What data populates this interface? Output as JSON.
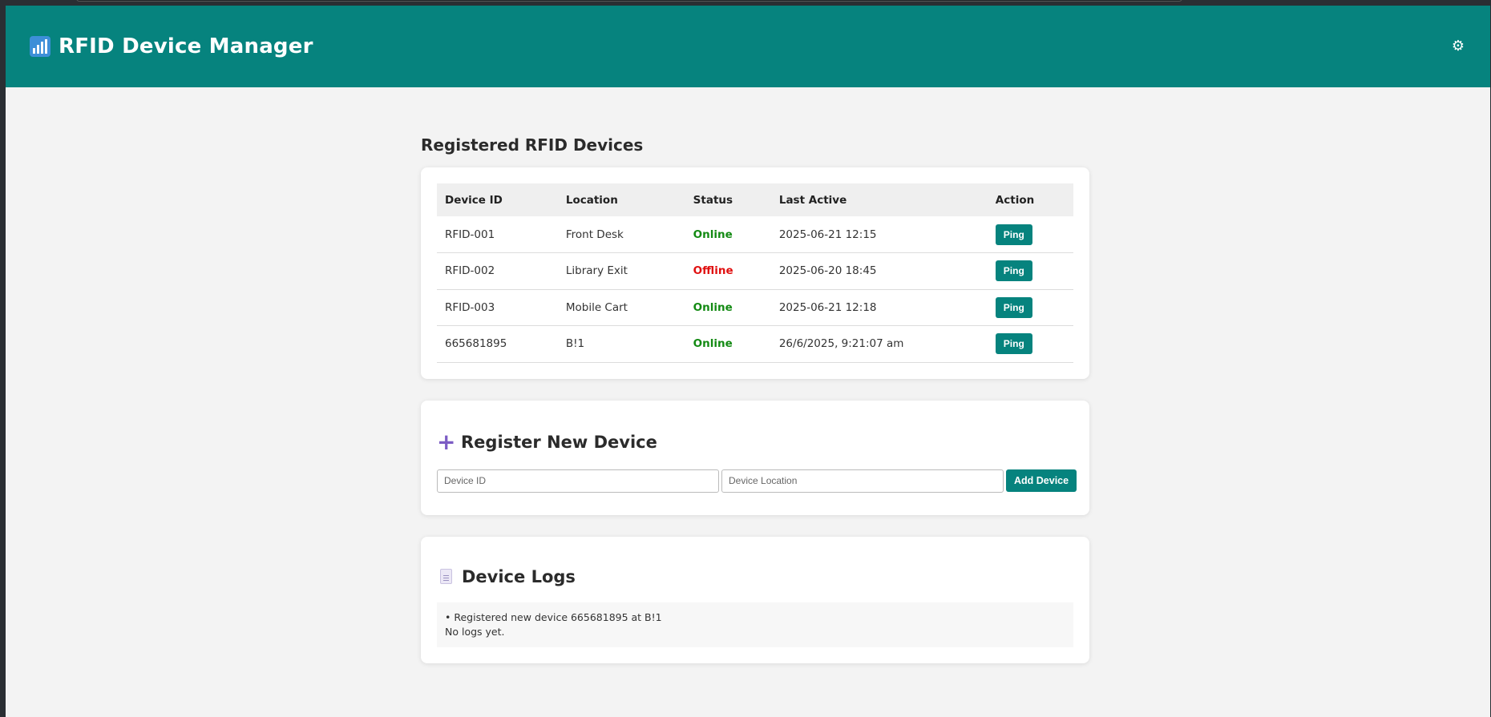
{
  "header": {
    "title": "RFID Device Manager",
    "brand_icon": "bar-chart-icon",
    "settings_icon": "gear-icon"
  },
  "devices_section": {
    "title": "Registered RFID Devices",
    "columns": [
      "Device ID",
      "Location",
      "Status",
      "Last Active",
      "Action"
    ],
    "rows": [
      {
        "id": "RFID-001",
        "location": "Front Desk",
        "status": "Online",
        "last_active": "2025-06-21 12:15",
        "action": "Ping"
      },
      {
        "id": "RFID-002",
        "location": "Library Exit",
        "status": "Offline",
        "last_active": "2025-06-20 18:45",
        "action": "Ping"
      },
      {
        "id": "RFID-003",
        "location": "Mobile Cart",
        "status": "Online",
        "last_active": "2025-06-21 12:18",
        "action": "Ping"
      },
      {
        "id": "665681895",
        "location": "B!1",
        "status": "Online",
        "last_active": "26/6/2025, 9:21:07 am",
        "action": "Ping"
      }
    ]
  },
  "register_section": {
    "title": "Register New Device",
    "icon": "plus-icon",
    "device_id_placeholder": "Device ID",
    "device_id_value": "",
    "location_placeholder": "Device Location",
    "location_value": "",
    "add_button": "Add Device"
  },
  "logs_section": {
    "title": "Device Logs",
    "icon": "document-icon",
    "entries": [
      "• Registered new device 665681895 at B!1",
      "No logs yet."
    ]
  },
  "colors": {
    "primary": "#06837e",
    "online": "#138a13",
    "offline": "#e01010",
    "accent": "#7c5cc4"
  }
}
